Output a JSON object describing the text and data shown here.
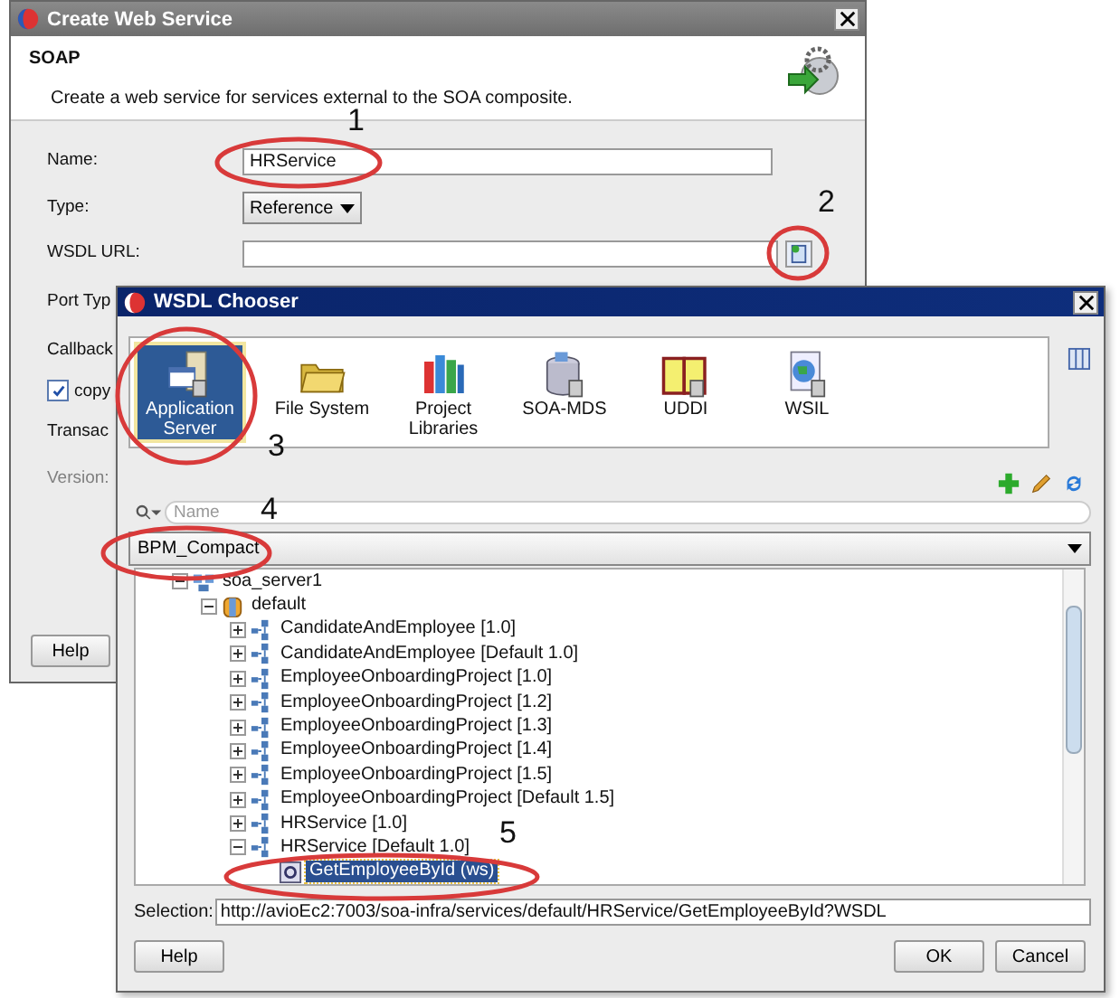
{
  "back_window": {
    "title": "Create Web Service",
    "header": {
      "title": "SOAP",
      "description": "Create a web service for services external to the SOA composite."
    },
    "fields": [
      {
        "kind": "text",
        "label": "Name:",
        "value": "HRService"
      },
      {
        "kind": "dropdown",
        "label": "Type:",
        "value": "Reference"
      },
      {
        "kind": "browse",
        "label": "WSDL URL:"
      },
      {
        "kind": "label",
        "label": "Port Typ"
      },
      {
        "kind": "label",
        "label": "Callback"
      },
      {
        "kind": "checkbox",
        "label": "copy",
        "checked": true
      },
      {
        "kind": "label",
        "label": "Transac"
      },
      {
        "kind": "label",
        "label": "Version:",
        "disabled": true
      }
    ],
    "help_button": "Help"
  },
  "chooser": {
    "title": "WSDL Chooser",
    "sources": [
      {
        "kind": "server",
        "label": "Application Server",
        "selected": true
      },
      {
        "kind": "folder",
        "label": "File System",
        "selected": false
      },
      {
        "kind": "books",
        "label": "Project Libraries",
        "selected": false
      },
      {
        "kind": "database",
        "label": "SOA-MDS",
        "selected": false
      },
      {
        "kind": "book",
        "label": "UDDI",
        "selected": false
      },
      {
        "kind": "globe",
        "label": "WSIL",
        "selected": false
      }
    ],
    "search": {
      "placeholder": "Name"
    },
    "connection": "BPM_Compact",
    "tree": [
      {
        "label": "soa_server1",
        "kind": "server",
        "expanded": true,
        "selected": false,
        "children": [
          {
            "label": "default",
            "kind": "partition",
            "expanded": true,
            "selected": false,
            "children": [
              {
                "label": "CandidateAndEmployee [1.0]",
                "kind": "composite",
                "expanded": false,
                "selected": false
              },
              {
                "label": "CandidateAndEmployee [Default 1.0]",
                "kind": "composite",
                "expanded": false,
                "selected": false
              },
              {
                "label": "EmployeeOnboardingProject [1.0]",
                "kind": "composite",
                "expanded": false,
                "selected": false
              },
              {
                "label": "EmployeeOnboardingProject [1.2]",
                "kind": "composite",
                "expanded": false,
                "selected": false
              },
              {
                "label": "EmployeeOnboardingProject [1.3]",
                "kind": "composite",
                "expanded": false,
                "selected": false
              },
              {
                "label": "EmployeeOnboardingProject [1.4]",
                "kind": "composite",
                "expanded": false,
                "selected": false
              },
              {
                "label": "EmployeeOnboardingProject [1.5]",
                "kind": "composite",
                "expanded": false,
                "selected": false
              },
              {
                "label": "EmployeeOnboardingProject [Default 1.5]",
                "kind": "composite",
                "expanded": false,
                "selected": false
              },
              {
                "label": "HRService [1.0]",
                "kind": "composite",
                "expanded": false,
                "selected": false
              },
              {
                "label": "HRService [Default 1.0]",
                "kind": "composite",
                "expanded": true,
                "selected": false,
                "children": [
                  {
                    "label": "GetEmployeeById (ws)",
                    "kind": "service",
                    "selected": true
                  }
                ]
              }
            ]
          }
        ]
      }
    ],
    "selection": {
      "label": "Selection:",
      "value": "http://avioEc2:7003/soa-infra/services/default/HRService/GetEmployeeById?WSDL"
    },
    "buttons": [
      "Help",
      "OK",
      "Cancel"
    ]
  },
  "annotations": [
    "1",
    "2",
    "3",
    "4",
    "5"
  ]
}
